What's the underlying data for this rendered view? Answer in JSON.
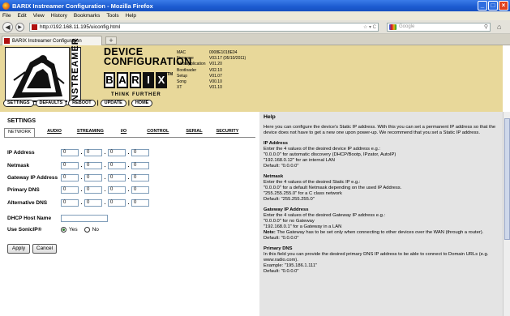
{
  "window": {
    "title": "BARIX Instreamer Configuration - Mozilla Firefox"
  },
  "menu": [
    "File",
    "Edit",
    "View",
    "History",
    "Bookmarks",
    "Tools",
    "Help"
  ],
  "nav": {
    "url": "http://192.168.11.195/uiconfig.html",
    "search_placeholder": "Google"
  },
  "tab": {
    "label": "BARIX Instreamer Configuration"
  },
  "header": {
    "title_line1": "DEVICE",
    "title_line2": "CONFIGURATION",
    "brand_vertical": "INSTREAMER",
    "barix_letters": [
      "B",
      "A",
      "R",
      "I",
      "X"
    ],
    "tm": "TM",
    "tagline": "THINK FURTHER",
    "info": [
      {
        "k": "MAC",
        "v": "0008E1018E04"
      },
      {
        "k": "Firmware",
        "v": "V03.17 (05/10/2011)"
      },
      {
        "k": "Web application",
        "v": "V01.20"
      },
      {
        "k": "Bootloader",
        "v": "V02.10"
      },
      {
        "k": "Setup",
        "v": "V01.07"
      },
      {
        "k": "Song",
        "v": "V00.10"
      },
      {
        "k": "XT",
        "v": "V01.10"
      }
    ],
    "buttons": {
      "settings": "SETTINGS",
      "defaults": "DEFAULTS",
      "reboot": "REBOOT",
      "update": "UPDATE",
      "home": "HOME",
      "sep": "|"
    }
  },
  "settings": {
    "title": "SETTINGS",
    "tabs": [
      "NETWORK",
      "AUDIO",
      "STREAMING",
      "I/O",
      "CONTROL",
      "SERIAL",
      "SECURITY"
    ],
    "fields": {
      "ip": {
        "label": "IP Address",
        "values": [
          "0",
          "0",
          "0",
          "0"
        ]
      },
      "netmask": {
        "label": "Netmask",
        "values": [
          "0",
          "0",
          "0",
          "0"
        ]
      },
      "gateway": {
        "label": "Gateway IP Address",
        "values": [
          "0",
          "0",
          "0",
          "0"
        ]
      },
      "dns1": {
        "label": "Primary DNS",
        "values": [
          "0",
          "0",
          "0",
          "0"
        ]
      },
      "dns2": {
        "label": "Alternative DNS",
        "values": [
          "0",
          "0",
          "0",
          "0"
        ]
      }
    },
    "dhcp_label": "DHCP Host Name",
    "dhcp_value": "",
    "sonic_label": "Use SonicIP®",
    "yes": "Yes",
    "no": "No",
    "apply": "Apply",
    "cancel": "Cancel"
  },
  "help": {
    "title": "Help",
    "intro": "Here you can configure the device's Static IP address. With this you can set a permanent IP address so that the device does not have to get a new one upon power-up. We recommend that you set a Static IP address.",
    "sections": [
      {
        "title": "IP Address",
        "lines": [
          "Enter the 4 values of the desired device IP address e.g.:",
          "\"0.0.0.0\" for automatic discovery (DHCP/Bootp, IPzator, AutoIP)",
          "\"192.168.0.12\" for an internal LAN",
          "Default: \"0.0.0.0\""
        ]
      },
      {
        "title": "Netmask",
        "lines": [
          "Enter the 4 values of the desired Static IP e.g.:",
          "\"0.0.0.0\" for a default Netmask depending on the used IP Address.",
          "\"255.255.255.0\" for a C class network",
          "Default: \"255.255.255.0\""
        ]
      },
      {
        "title": "Gateway IP Address",
        "lines": [
          "Enter the 4 values of the desired Gateway IP address e.g.:",
          "\"0.0.0.0\" for no Gateway",
          "\"192.168.0.1\" for a Gateway in a LAN"
        ],
        "note_label": "Note:",
        "note": "The Gateway has to be set only when connecting to other devices over the WAN (through a router).",
        "default": "Default: \"0.0.0.0\""
      },
      {
        "title": "Primary DNS",
        "lines": [
          "In this field you can provide the desired primary DNS IP address to be able to connect to Domain URLs (e.g. www.radio.com).",
          "Example: \"195.186.1.111\"",
          "Default: \"0.0.0.0\""
        ]
      }
    ]
  }
}
